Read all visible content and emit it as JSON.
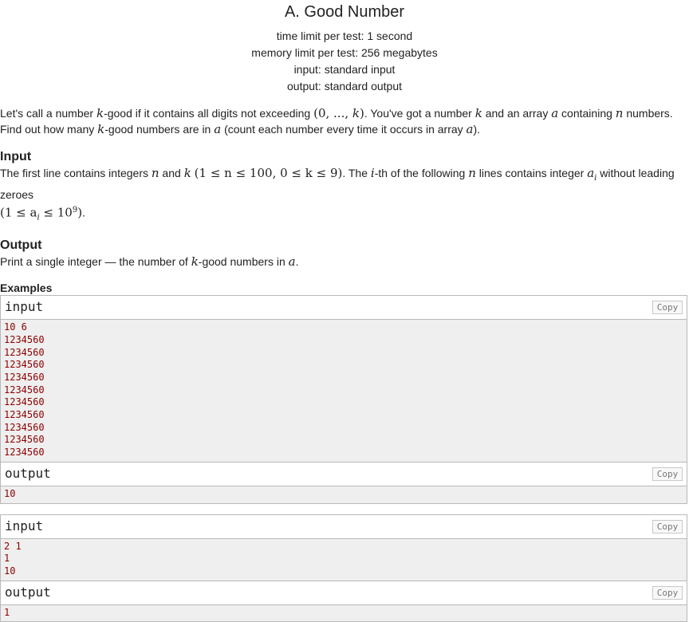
{
  "problem": {
    "title": "A. Good Number",
    "limits": [
      "time limit per test: 1 second",
      "memory limit per test: 256 megabytes",
      "input: standard input",
      "output: standard output"
    ]
  },
  "statement": {
    "l1_a": "Let's call a number ",
    "k": "k",
    "l1_b": "-good if it contains all digits not exceeding ",
    "range_open": "(0, ..., ",
    "range_close": ")",
    "l1_c": ". You've got a number ",
    "l1_d": " and an array ",
    "a": "a",
    "l1_e": " containing ",
    "n": "n",
    "l1_f": " numbers.",
    "l2_a": "Find out how many ",
    "l2_b": "-good numbers are in ",
    "l2_c": " (count each number every time it occurs in array ",
    "l2_d": ")."
  },
  "input_section": {
    "heading": "Input",
    "t1": "The first line contains integers ",
    "t2": " and ",
    "cond1": "(1 ≤ n ≤ 100, 0 ≤ k ≤ 9)",
    "t3": ". The ",
    "i": "i",
    "t4": "-th of the following ",
    "t5": " lines contains integer ",
    "ai": "a",
    "ai_sub": "i",
    "t6": " without leading zeroes",
    "cond2_a": "(1 ≤ a",
    "cond2_sub": "i",
    "cond2_b": " ≤ 10",
    "cond2_sup": "9",
    "cond2_c": ")",
    "t7": "."
  },
  "output_section": {
    "heading": "Output",
    "t1": "Print a single integer — the number of ",
    "t2": "-good numbers in ",
    "t3": "."
  },
  "examples": {
    "heading": "Examples",
    "copy_label": "Copy",
    "input_label": "input",
    "output_label": "output",
    "ex1_input": [
      "10 6",
      "1234560",
      "1234560",
      "1234560",
      "1234560",
      "1234560",
      "1234560",
      "1234560",
      "1234560",
      "1234560",
      "1234560"
    ],
    "ex1_output": [
      "10"
    ],
    "ex2_input": [
      "2 1",
      "1",
      "10"
    ],
    "ex2_output": [
      "1"
    ]
  }
}
